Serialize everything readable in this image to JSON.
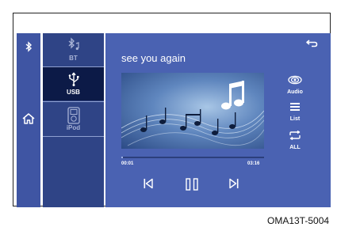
{
  "rail": {
    "bluetooth_icon": "bluetooth-icon",
    "home_icon": "home-icon"
  },
  "sources": [
    {
      "label": "BT",
      "icon": "bluetooth-music-icon",
      "selected": false
    },
    {
      "label": "USB",
      "icon": "usb-icon",
      "selected": true
    },
    {
      "label": "iPod",
      "icon": "ipod-icon",
      "selected": false
    }
  ],
  "player": {
    "track_title": "see you again",
    "elapsed": "00:01",
    "duration": "03:16",
    "progress_fraction": 0.005
  },
  "side_buttons": {
    "audio_label": "Audio",
    "list_label": "List",
    "repeat_label": "ALL"
  },
  "caption": "OMA13T-5004",
  "colors": {
    "rail": "#3f55a3",
    "sources_bg": "#2f4486",
    "selected_source": "#0c1a47",
    "main_bg": "#4a62b2"
  }
}
